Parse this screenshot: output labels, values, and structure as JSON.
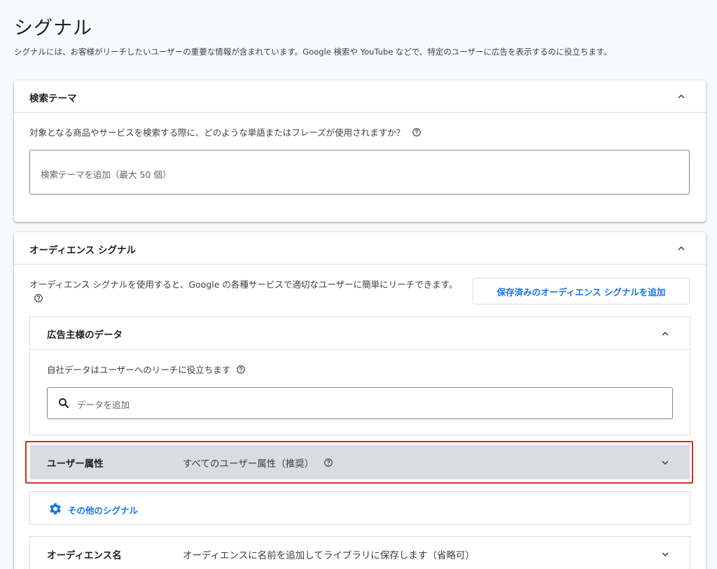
{
  "page": {
    "title": "シグナル",
    "description": "シグナルには、お客様がリーチしたいユーザーの重要な情報が含まれています。Google 検索や YouTube などで、特定のユーザーに広告を表示するのに役立ちます。"
  },
  "search_theme": {
    "title": "検索テーマ",
    "question": "対象となる商品やサービスを検索する際に、どのような単語またはフレーズが使用されますか？",
    "input_placeholder": "検索テーマを追加（最大 50 個）"
  },
  "audience_signal": {
    "title": "オーディエンス シグナル",
    "description": "オーディエンス シグナルを使用すると、Google の各種サービスで適切なユーザーに簡単にリーチできます。",
    "add_saved_button": "保存済みのオーディエンス シグナルを追加",
    "advertiser_data": {
      "title": "広告主様のデータ",
      "description": "自社データはユーザーへのリーチに役立ちます",
      "input_placeholder": "データを追加"
    },
    "demographics": {
      "label": "ユーザー属性",
      "value": "すべてのユーザー属性（推奨）",
      "highlight_color": "#d93025"
    },
    "other_signals": {
      "label": "その他のシグナル",
      "icon": "gear-icon"
    },
    "audience_name": {
      "label": "オーディエンス名",
      "value": "オーディエンスに名前を追加してライブラリに保存します（省略可）"
    }
  },
  "colors": {
    "accent": "#1a73e8",
    "highlight_border": "#d93025"
  }
}
